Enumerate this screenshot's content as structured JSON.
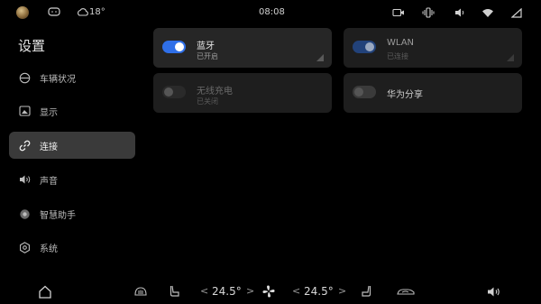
{
  "status_bar": {
    "temperature": "18°",
    "time": "08:08"
  },
  "sidebar": {
    "title": "设置",
    "items": [
      {
        "label": "车辆状况",
        "icon": "car-status-icon"
      },
      {
        "label": "显示",
        "icon": "display-icon"
      },
      {
        "label": "连接",
        "icon": "link-icon"
      },
      {
        "label": "声音",
        "icon": "speaker-icon"
      },
      {
        "label": "智慧助手",
        "icon": "assistant-icon"
      },
      {
        "label": "系统",
        "icon": "gear-icon"
      }
    ],
    "active_index": 2
  },
  "cards": [
    {
      "title": "蓝牙",
      "subtitle": "已开启",
      "toggle_on": true
    },
    {
      "title": "WLAN",
      "subtitle": "已连接",
      "toggle_on": true
    },
    {
      "title": "无线充电",
      "subtitle": "已关闭",
      "toggle_on": false
    },
    {
      "title": "华为分享",
      "subtitle": "",
      "toggle_on": false
    }
  ],
  "bottom_bar": {
    "left_temp": "24.5°",
    "right_temp": "24.5°",
    "chevron_left": "<",
    "chevron_right": ">"
  },
  "colors": {
    "accent": "#2f6fe8",
    "background": "#000000",
    "active_nav": "#3a3a3a"
  }
}
